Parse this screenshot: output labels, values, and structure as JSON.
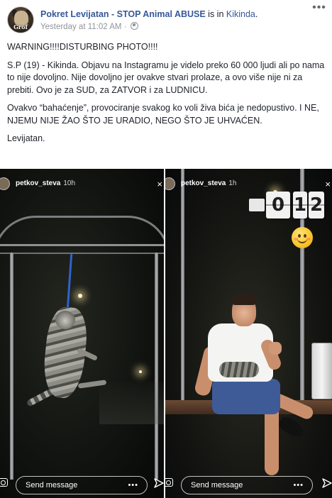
{
  "post": {
    "page_name": "Pokret Levijatan - STOP Animal ABUSE",
    "is_in_text": " is in ",
    "location": "Kikinda",
    "location_suffix": ".",
    "timestamp": "Yesterday at 11:02 AM",
    "separator": " · ",
    "privacy_icon": "globe-icon",
    "avatar_label": "Grof",
    "more_options_icon": "ellipsis-icon",
    "more_options_label": "•••"
  },
  "body": {
    "paragraphs": [
      "WARNING!!!!DISTURBING PHOTO!!!!",
      "S.P (19) - Kikinda. Objavu na Instagramu je videlo preko 60 000 ljudi ali po nama to nije dovoljno. Nije dovoljno jer ovakve stvari prolaze, a ovo više nije ni za prebiti. Ovo je za SUD, za ZATVOR i za LUDNICU.",
      "Ovakvo “bahaćenje”, provociranje svakog ko voli živa bića je nedopustivo. I NE, NJEMU NIJE ŽAO ŠTO JE URADIO, NEGO ŠTO JE UHVAĆEN.",
      "Levijatan."
    ]
  },
  "stories": [
    {
      "username": "petkov_steva",
      "time": "10h",
      "close_label": "×",
      "send_message": "Send message",
      "dots": "•••"
    },
    {
      "username": "petkov_steva",
      "time": "1h",
      "close_label": "×",
      "send_message": "Send message",
      "dots": "•••",
      "clock_sticker": {
        "hour": "0",
        "minute_tens": "1",
        "minute_ones": "2"
      }
    }
  ],
  "colors": {
    "link_blue": "#365899",
    "meta_gray": "#90949c",
    "text": "#1d2129",
    "rope_blue": "#2d64c9"
  }
}
